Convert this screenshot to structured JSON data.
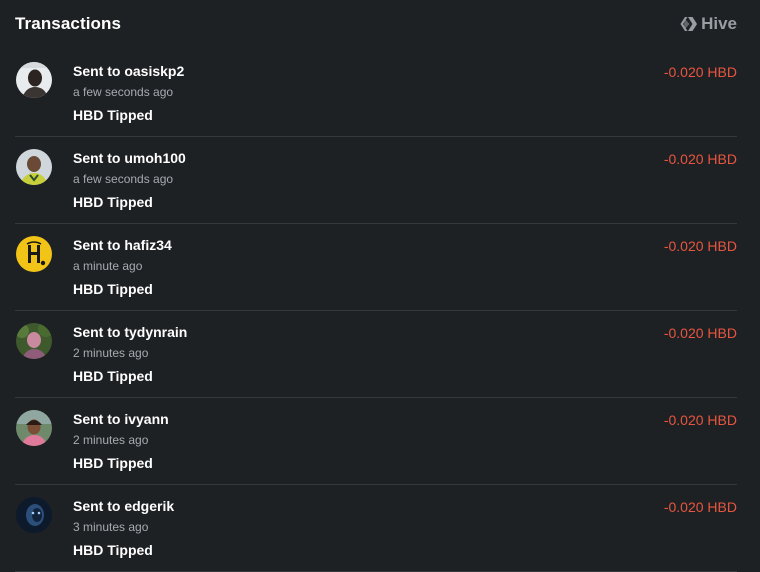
{
  "header": {
    "title": "Transactions",
    "brand": "Hive",
    "brand_icon": "hive-logo-icon"
  },
  "colors": {
    "background": "#1e2124",
    "amount_negative": "#e8553f",
    "muted_text": "#a7abaf",
    "divider": "#34383c"
  },
  "transactions": [
    {
      "prefix": "Sent to",
      "user": "oasiskp2",
      "time": "a few seconds ago",
      "memo": "HBD Tipped",
      "amount": "-0.020 HBD",
      "avatar_icon": "user-avatar-oasiskp2"
    },
    {
      "prefix": "Sent to",
      "user": "umoh100",
      "time": "a few seconds ago",
      "memo": "HBD Tipped",
      "amount": "-0.020 HBD",
      "avatar_icon": "user-avatar-umoh100"
    },
    {
      "prefix": "Sent to",
      "user": "hafiz34",
      "time": "a minute ago",
      "memo": "HBD Tipped",
      "amount": "-0.020 HBD",
      "avatar_icon": "user-avatar-hafiz34"
    },
    {
      "prefix": "Sent to",
      "user": "tydynrain",
      "time": "2 minutes ago",
      "memo": "HBD Tipped",
      "amount": "-0.020 HBD",
      "avatar_icon": "user-avatar-tydynrain"
    },
    {
      "prefix": "Sent to",
      "user": "ivyann",
      "time": "2 minutes ago",
      "memo": "HBD Tipped",
      "amount": "-0.020 HBD",
      "avatar_icon": "user-avatar-ivyann"
    },
    {
      "prefix": "Sent to",
      "user": "edgerik",
      "time": "3 minutes ago",
      "memo": "HBD Tipped",
      "amount": "-0.020 HBD",
      "avatar_icon": "user-avatar-edgerik"
    }
  ]
}
